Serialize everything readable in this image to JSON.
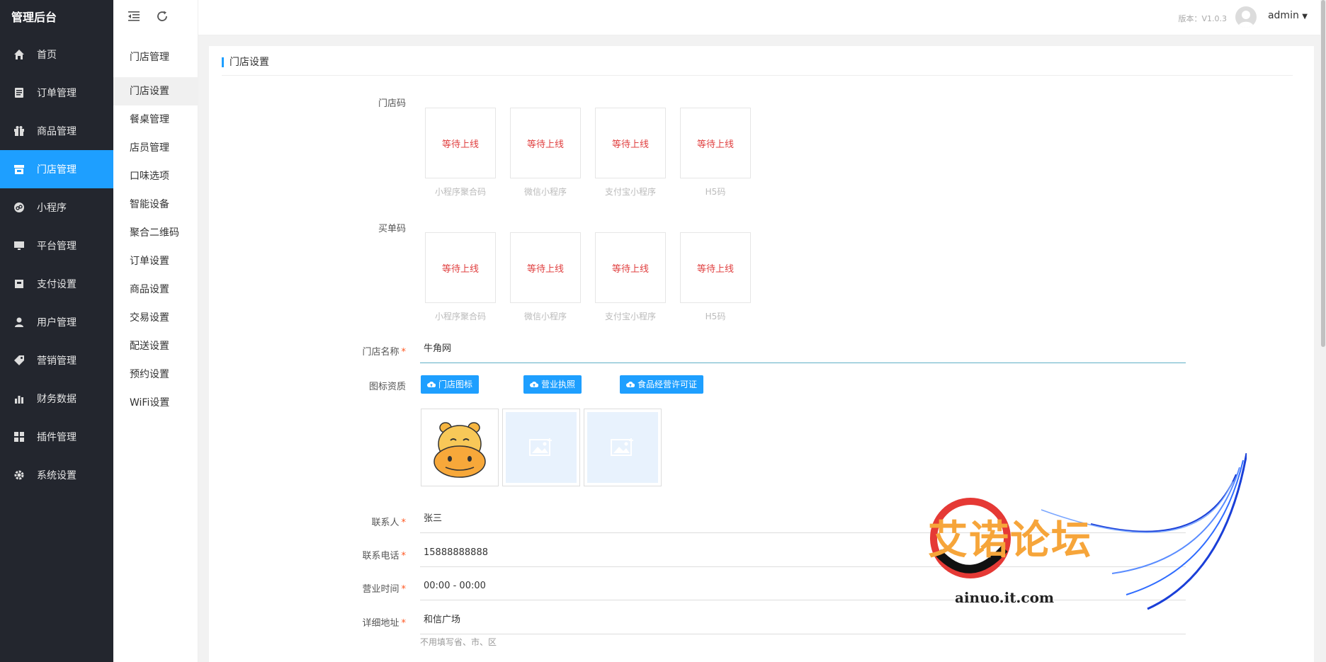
{
  "sidebar": {
    "brand": "管理后台",
    "items": [
      {
        "label": "首页",
        "icon": "home-icon"
      },
      {
        "label": "订单管理",
        "icon": "order-icon"
      },
      {
        "label": "商品管理",
        "icon": "gift-icon"
      },
      {
        "label": "门店管理",
        "icon": "store-icon",
        "active": true
      },
      {
        "label": "小程序",
        "icon": "miniapp-icon"
      },
      {
        "label": "平台管理",
        "icon": "monitor-icon"
      },
      {
        "label": "支付设置",
        "icon": "wallet-icon"
      },
      {
        "label": "用户管理",
        "icon": "user-icon"
      },
      {
        "label": "营销管理",
        "icon": "tag-icon"
      },
      {
        "label": "财务数据",
        "icon": "chart-icon"
      },
      {
        "label": "插件管理",
        "icon": "plugin-icon"
      },
      {
        "label": "系统设置",
        "icon": "gear-icon"
      }
    ]
  },
  "submenu": {
    "title": "门店管理",
    "items": [
      "门店设置",
      "餐桌管理",
      "店员管理",
      "口味选项",
      "智能设备",
      "聚合二维码",
      "订单设置",
      "商品设置",
      "交易设置",
      "配送设置",
      "预约设置",
      "WiFi设置"
    ]
  },
  "topbar": {
    "version": "版本：V1.0.3",
    "user": "admin"
  },
  "panel": {
    "title": "门店设置",
    "store_code_label": "门店码",
    "pay_code_label": "买单码",
    "qr_placeholder": "等待上线",
    "qr_captions": [
      "小程序聚合码",
      "微信小程序",
      "支付宝小程序",
      "H5码"
    ],
    "store_name_label": "门店名称",
    "store_name_value": "牛角网",
    "icon_label": "图标资质",
    "upload_buttons": [
      "门店图标",
      "营业执照",
      "食品经营许可证"
    ],
    "contact_label": "联系人",
    "contact_value": "张三",
    "phone_label": "联系电话",
    "phone_value": "15888888888",
    "hours_label": "营业时间",
    "hours_value": "00:00 - 00:00",
    "address_label": "详细地址",
    "address_value": "和信广场",
    "address_hint": "不用填写省、市、区",
    "required_mark": "*"
  },
  "watermark": {
    "text": "艾诺论坛",
    "url": "ainuo.it.com"
  }
}
